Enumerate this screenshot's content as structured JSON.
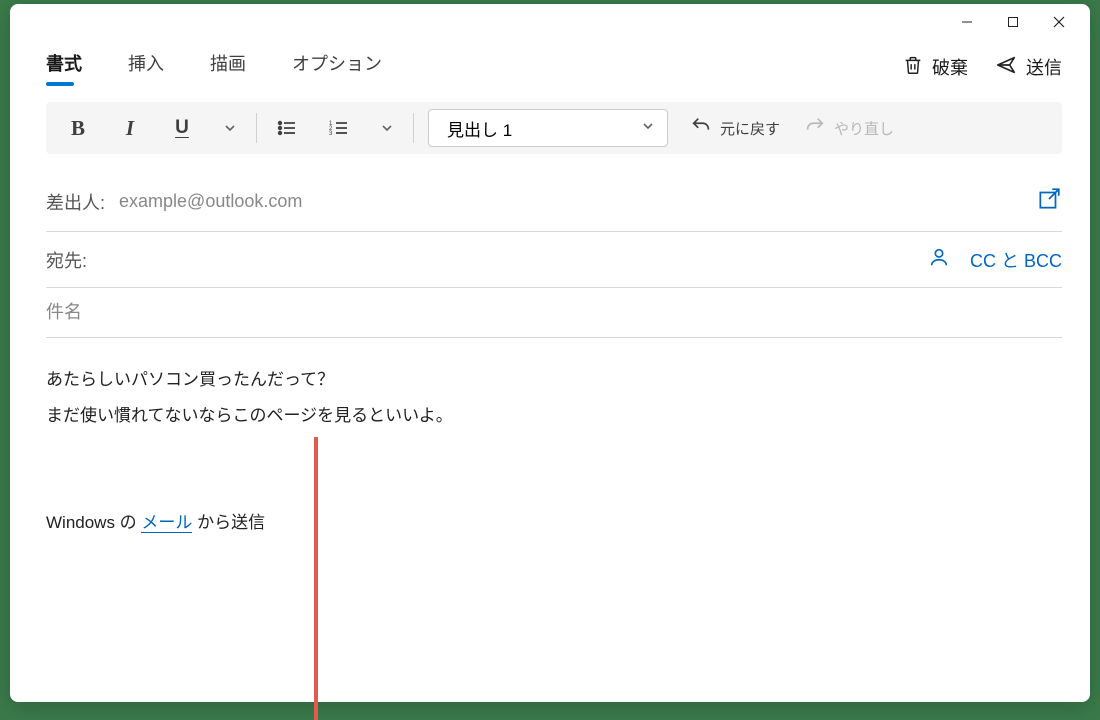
{
  "tabs": {
    "format": "書式",
    "insert": "挿入",
    "draw": "描画",
    "options": "オプション"
  },
  "actions": {
    "discard": "破棄",
    "send": "送信"
  },
  "toolbar": {
    "style_select": "見出し 1",
    "undo": "元に戻す",
    "redo": "やり直し"
  },
  "fields": {
    "from_label": "差出人:",
    "from_value": "example@outlook.com",
    "to_label": "宛先:",
    "cc_bcc": "CC と BCC",
    "subject_placeholder": "件名"
  },
  "body": {
    "line1": "あたらしいパソコン買ったんだって？",
    "line2": "まだ使い慣れてないならこのページを見るといいよ。",
    "sig_prefix": "Windows の ",
    "sig_link": "メール",
    "sig_suffix": " から送信"
  }
}
